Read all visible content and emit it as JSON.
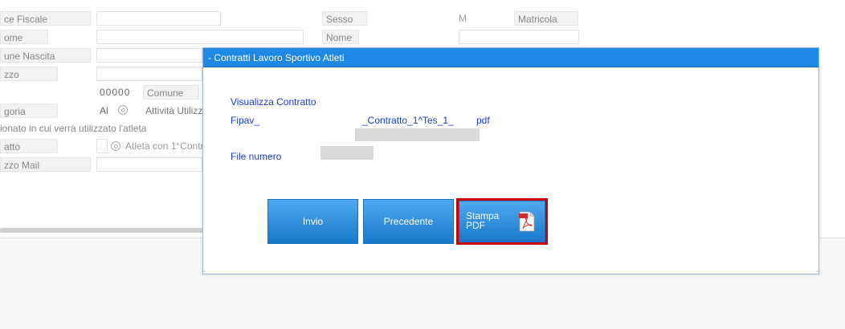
{
  "form": {
    "codice_fiscale_label": "ce Fiscale",
    "sesso_label": "Sesso",
    "sesso_value": "M",
    "matricola_label": "Matricola",
    "cognome_label": "ome",
    "nome_label": "Nome",
    "comune_nascita_label": "une Nascita",
    "indirizzo_label": "zzo",
    "cap_value": "00000",
    "comune_label": "Comune",
    "categoria_label": "goria",
    "categoria_value": "Al",
    "attivita_label": "Attività Utilizz",
    "section_text": "ionato in cui verrà utilizzato l'atleta",
    "contratto_label": "atto",
    "atleta_label": "Atleta con 1°Contr",
    "mail_label": "zzo Mail"
  },
  "modal": {
    "title": "- Contratti Lavoro Sportivo Atleti",
    "visualizza_label": "Visualizza Contratto",
    "file_prefix": "Fipav_",
    "file_middle": "_Contratto_1^Tes_1_",
    "file_ext": "pdf",
    "file_numero_label": "File numero",
    "buttons": {
      "invio": "Invio",
      "precedente": "Precedente",
      "stampa_line1": "Stampa",
      "stampa_line2": "PDF"
    }
  },
  "icons": {
    "search": "search-icon",
    "pdf": "pdf-icon"
  },
  "colors": {
    "header_bg": "#1e88e5",
    "button_bg": "#2a8ae0",
    "link_text": "#1a3ccc",
    "highlight_border": "#cc0000"
  }
}
